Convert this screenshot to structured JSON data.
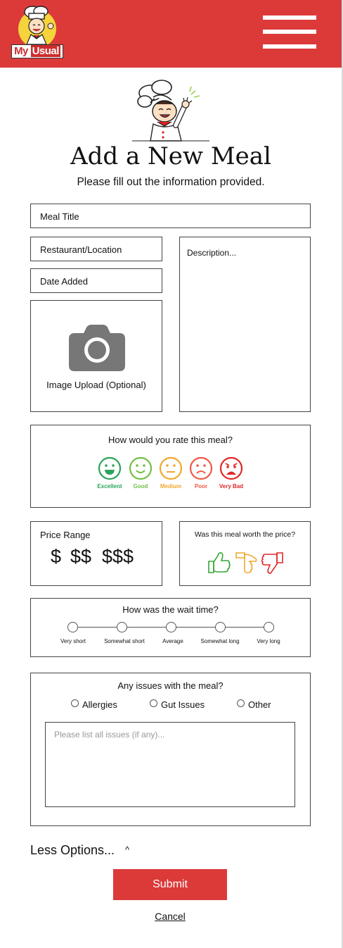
{
  "header": {
    "logo": {
      "text_my": "My",
      "text_usual": "Usual",
      "icon": "chef-mascot"
    },
    "menu_icon": "hamburger-menu-icon"
  },
  "main": {
    "mascot_icon": "chef-mascot-waving",
    "title": "Add a New Meal",
    "subtitle": "Please fill out the information provided."
  },
  "form": {
    "meal_title_placeholder": "Meal Title",
    "restaurant_placeholder": "Restaurant/Location",
    "date_placeholder": "Date Added",
    "description_placeholder": "Description...",
    "image_upload": {
      "label": "Image Upload (Optional)",
      "icon": "camera-icon"
    },
    "rating": {
      "question": "How would you rate this meal?",
      "options": [
        {
          "label": "Excellent",
          "color": "#2aa35a",
          "icon": "excellent-face-icon"
        },
        {
          "label": "Good",
          "color": "#72bf44",
          "icon": "good-face-icon"
        },
        {
          "label": "Medium",
          "color": "#f0a82e",
          "icon": "medium-face-icon"
        },
        {
          "label": "Poor",
          "color": "#ee5a45",
          "icon": "poor-face-icon"
        },
        {
          "label": "Very Bad",
          "color": "#e02828",
          "icon": "very-bad-face-icon"
        }
      ]
    },
    "price_range": {
      "title": "Price Range",
      "options": [
        "$",
        "$$",
        "$$$"
      ]
    },
    "worth": {
      "question": "Was this meal worth the price?",
      "options": [
        {
          "icon": "thumbs-up-icon",
          "color": "#35a633"
        },
        {
          "icon": "thumbs-sideways-icon",
          "color": "#f0a82e"
        },
        {
          "icon": "thumbs-down-icon",
          "color": "#e02828"
        }
      ]
    },
    "wait_time": {
      "question": "How was the wait time?",
      "options": [
        "Very short",
        "Somewhat short",
        "Average",
        "Somewhat long",
        "Very long"
      ]
    },
    "issues": {
      "question": "Any issues with the meal?",
      "options": [
        "Allergies",
        "Gut Issues",
        "Other"
      ],
      "textarea_placeholder": "Please list all issues (if any)..."
    }
  },
  "actions": {
    "less_options": "Less Options...",
    "less_caret": "^",
    "submit": "Submit",
    "cancel": "Cancel"
  },
  "colors": {
    "brand_red": "#db3a39"
  }
}
